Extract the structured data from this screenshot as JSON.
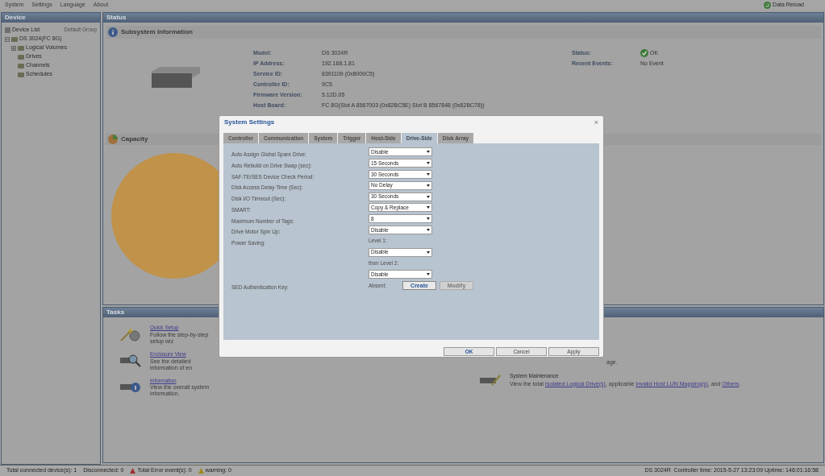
{
  "menu": [
    "System",
    "Settings",
    "Language",
    "About"
  ],
  "data_reload": "Data Reload",
  "device_panel": {
    "title": "Device",
    "list_label": "Device List",
    "group": "Default Group",
    "tree": [
      {
        "label": "DS 3024(FC 8G)",
        "expanded": true,
        "children": [
          {
            "label": "Logical Volumes",
            "expanded": false
          },
          {
            "label": "Drives"
          },
          {
            "label": "Channels"
          },
          {
            "label": "Schedules"
          }
        ]
      }
    ]
  },
  "status_panel": {
    "title": "Status",
    "subsystem_title": "Subsystem Information",
    "info": [
      {
        "label": "Model:",
        "value": "DS 3024R"
      },
      {
        "label": "IP Address:",
        "value": "192.168.1.81"
      },
      {
        "label": "Service ID:",
        "value": "8391109 (0x8009C5)"
      },
      {
        "label": "Controller ID:",
        "value": "9C5"
      },
      {
        "label": "Firmware Version:",
        "value": "5.12D.05"
      },
      {
        "label": "Host Board:",
        "value": "FC 8G(Slot A 8567003 (0x82BC5E) Slot B 8567848 (0x82BC78))"
      }
    ],
    "status_label": "Status:",
    "status_value": "OK",
    "events_label": "Recent Events:",
    "events_value": "No Event",
    "capacity_title": "Capacity"
  },
  "tasks": {
    "title": "Tasks",
    "items": [
      {
        "kind": "quick",
        "link": "Quick Setup",
        "desc": "Follow the step-by-step setup wiz"
      },
      {
        "kind": "enclosure",
        "link": "Enclosure View",
        "desc": "See the detailed information of en"
      },
      {
        "kind": "info",
        "link": "Information",
        "desc": "View the overall system information."
      }
    ],
    "side_fragment": "age.",
    "maintenance": {
      "title": "System Maintenance",
      "parts": [
        "View the total ",
        "Isolated Logical Drive(s)",
        ", applicable ",
        "Invalid Host LUN Mapping(s)",
        ", and ",
        "Others",
        "."
      ]
    }
  },
  "dialog": {
    "title": "System Settings",
    "close": "×",
    "tabs": [
      {
        "label": "Controller",
        "selected": false
      },
      {
        "label": "Communication",
        "selected": false
      },
      {
        "label": "System",
        "selected": false
      },
      {
        "label": "Trigger",
        "selected": false
      },
      {
        "label": "Host-Side",
        "selected": false
      },
      {
        "label": "Drive-Side",
        "selected": true
      },
      {
        "label": "Disk Array",
        "selected": false
      }
    ],
    "rows": [
      {
        "kind": "select",
        "label": "Auto Assign Global Spare Drive:",
        "value": "Disable"
      },
      {
        "kind": "select",
        "label": "Auto Rebuild on Drive Swap (sec):",
        "value": "15 Seconds"
      },
      {
        "kind": "select",
        "label": "SAF-TE/SES Device Check Period:",
        "value": "30 Seconds"
      },
      {
        "kind": "select",
        "label": "Disk Access Delay Time (Sec):",
        "value": "No Delay"
      },
      {
        "kind": "select",
        "label": "Disk I/O Timeout (Sec):",
        "value": "30 Seconds"
      },
      {
        "kind": "select",
        "label": "SMART:",
        "value": "Copy & Replace"
      },
      {
        "kind": "select",
        "label": "Maximum Number of Tags:",
        "value": "8"
      },
      {
        "kind": "select",
        "label": "Drive Motor Spin Up:",
        "value": "Disable"
      },
      {
        "kind": "note",
        "label": "Power Saving:",
        "value": "Level 1:"
      },
      {
        "kind": "select",
        "value": "Disable"
      },
      {
        "kind": "note",
        "value": "then Level 2:"
      },
      {
        "kind": "select",
        "value": "Disable"
      },
      {
        "kind": "key",
        "label": "SED Authentication Key:",
        "value": "Absent:",
        "buttons": [
          {
            "label": "Create",
            "disabled": false
          },
          {
            "label": "Modify",
            "disabled": true
          }
        ]
      }
    ],
    "buttons": [
      "OK",
      "Cancel",
      "Apply"
    ]
  },
  "status_bar": {
    "left": [
      "Total connected device(s): 1",
      "Disconnected: 0"
    ],
    "errors": "Total Error event(s): 0",
    "warnings": "warning: 0",
    "right": "DS 3024R  Controller time: 2015-5-27 13:23:09 Uptime: 146:01:16:58"
  }
}
